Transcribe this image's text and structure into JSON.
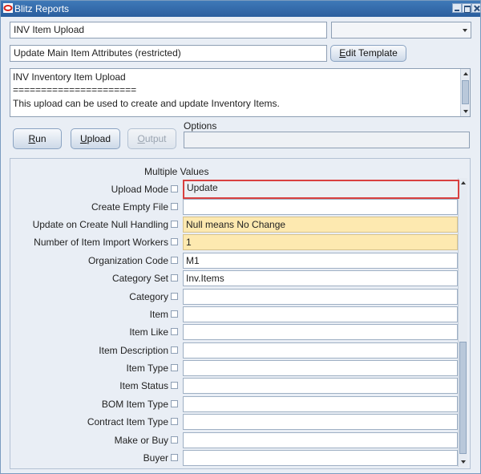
{
  "window": {
    "title": "Blitz Reports"
  },
  "report": {
    "name": "INV Item Upload",
    "template": "Update Main Item Attributes (restricted)",
    "edit_template_prefix": "E",
    "edit_template_rest": "dit Template",
    "description": [
      "INV Inventory Item Upload",
      "======================",
      "This upload can be used to create and update Inventory Items."
    ]
  },
  "actions": {
    "run_mnemonic": "R",
    "run_rest": "un",
    "upload_mnemonic": "U",
    "upload_rest": "pload",
    "output_mnemonic": "O",
    "output_rest": "utput"
  },
  "options": {
    "label": "Options",
    "value": ""
  },
  "parameters": {
    "multiple_values_label": "Multiple Values",
    "rows": [
      {
        "label": "Upload Mode",
        "value": "Update"
      },
      {
        "label": "Create Empty File",
        "value": ""
      },
      {
        "label": "Update on Create Null Handling",
        "value": "Null means No Change"
      },
      {
        "label": "Number of Item Import Workers",
        "value": "1"
      },
      {
        "label": "Organization Code",
        "value": "M1"
      },
      {
        "label": "Category Set",
        "value": "Inv.Items"
      },
      {
        "label": "Category",
        "value": ""
      },
      {
        "label": "Item",
        "value": ""
      },
      {
        "label": "Item Like",
        "value": ""
      },
      {
        "label": "Item Description",
        "value": ""
      },
      {
        "label": "Item Type",
        "value": ""
      },
      {
        "label": "Item Status",
        "value": ""
      },
      {
        "label": "BOM Item Type",
        "value": ""
      },
      {
        "label": "Contract Item Type",
        "value": ""
      },
      {
        "label": "Make or Buy",
        "value": ""
      },
      {
        "label": "Buyer",
        "value": ""
      }
    ]
  },
  "colors": {
    "title_bar": "#2a5e9e",
    "required_field": "#fde9b0",
    "focus_border": "#d94040"
  }
}
